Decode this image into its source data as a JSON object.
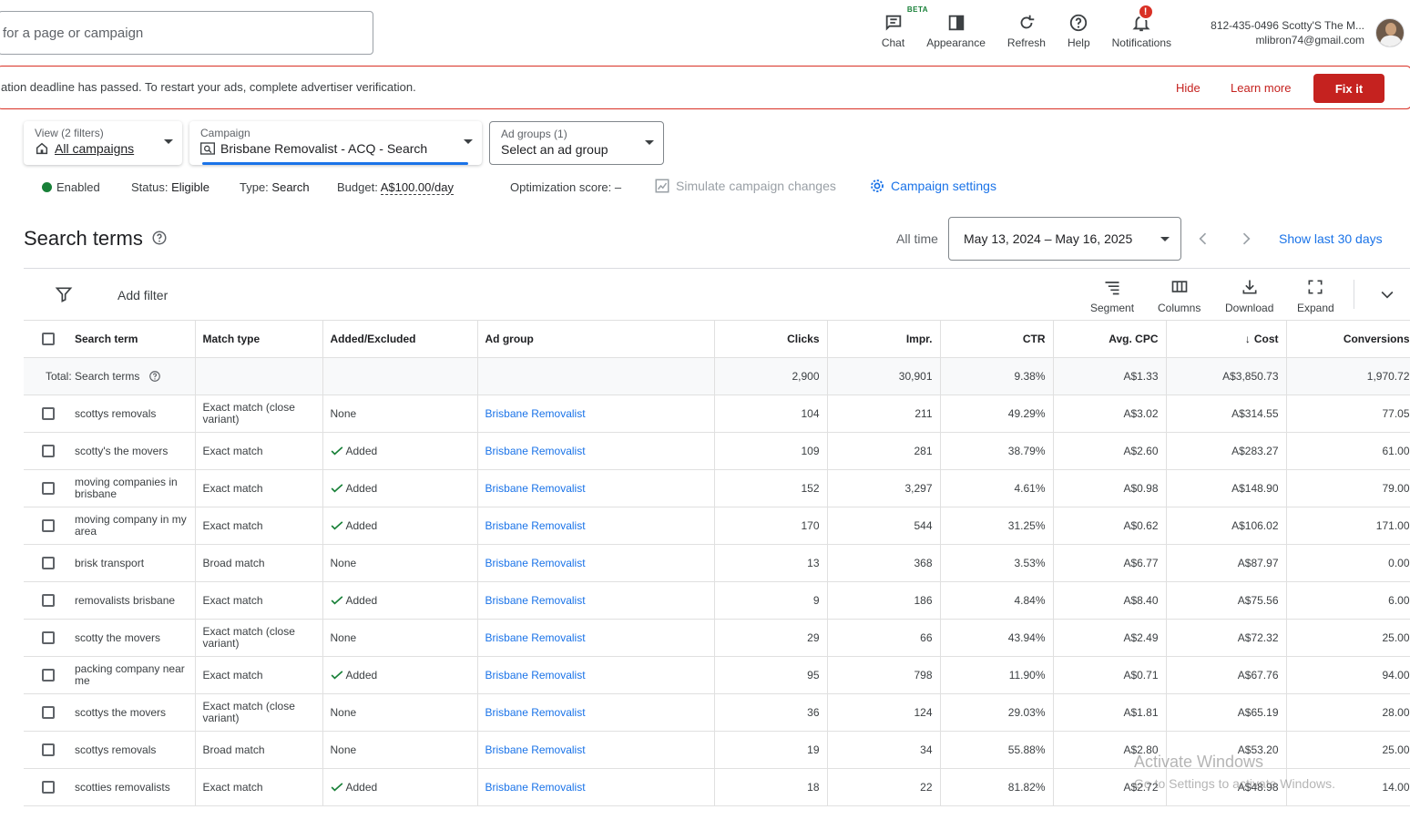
{
  "search": {
    "placeholder": "for a page or campaign"
  },
  "top_actions": [
    {
      "label": "Chat",
      "icon": "chat-icon",
      "badge": "BETA"
    },
    {
      "label": "Appearance",
      "icon": "appearance-icon"
    },
    {
      "label": "Refresh",
      "icon": "refresh-icon"
    },
    {
      "label": "Help",
      "icon": "help-icon"
    },
    {
      "label": "Notifications",
      "icon": "bell-icon",
      "badge": "!"
    }
  ],
  "account": {
    "name": "812-435-0496 Scotty'S The M...",
    "email": "mlibron74@gmail.com"
  },
  "alert": {
    "text": "ation deadline has passed. To restart your ads, complete advertiser verification.",
    "hide": "Hide",
    "learn_more": "Learn more",
    "fix": "Fix it"
  },
  "selectors": {
    "view": {
      "label": "View (2 filters)",
      "value": "All campaigns"
    },
    "campaign": {
      "label": "Campaign",
      "value": "Brisbane Removalist - ACQ - Search"
    },
    "adgroups": {
      "label": "Ad groups (1)",
      "value": "Select an ad group"
    }
  },
  "status": {
    "enabled": "Enabled",
    "status_label": "Status:",
    "status_value": "Eligible",
    "type_label": "Type:",
    "type_value": "Search",
    "budget_label": "Budget:",
    "budget_value": "A$100.00/day",
    "opt_label": "Optimization score:",
    "opt_value": "–",
    "simulate": "Simulate campaign changes",
    "settings": "Campaign settings"
  },
  "page": {
    "title": "Search terms",
    "all_time": "All time",
    "date_range": "May 13, 2024 – May 16, 2025",
    "show_last": "Show last 30 days"
  },
  "toolbar": {
    "add_filter": "Add filter",
    "segment": "Segment",
    "columns": "Columns",
    "download": "Download",
    "expand": "Expand"
  },
  "table": {
    "headers": [
      "Search term",
      "Match type",
      "Added/Excluded",
      "Ad group",
      "Clicks",
      "Impr.",
      "CTR",
      "Avg. CPC",
      "Cost",
      "Conversions"
    ],
    "total": {
      "label": "Total: Search terms",
      "clicks": "2,900",
      "impr": "30,901",
      "ctr": "9.38%",
      "cpc": "A$1.33",
      "cost": "A$3,850.73",
      "conv": "1,970.72"
    },
    "rows": [
      {
        "term": "scottys removals",
        "match": "Exact match (close variant)",
        "added": "None",
        "group": "Brisbane Removalist",
        "clicks": "104",
        "impr": "211",
        "ctr": "49.29%",
        "cpc": "A$3.02",
        "cost": "A$314.55",
        "conv": "77.05"
      },
      {
        "term": "scotty's the movers",
        "match": "Exact match",
        "added": "Added",
        "group": "Brisbane Removalist",
        "clicks": "109",
        "impr": "281",
        "ctr": "38.79%",
        "cpc": "A$2.60",
        "cost": "A$283.27",
        "conv": "61.00"
      },
      {
        "term": "moving companies in brisbane",
        "match": "Exact match",
        "added": "Added",
        "group": "Brisbane Removalist",
        "clicks": "152",
        "impr": "3,297",
        "ctr": "4.61%",
        "cpc": "A$0.98",
        "cost": "A$148.90",
        "conv": "79.00"
      },
      {
        "term": "moving company in my area",
        "match": "Exact match",
        "added": "Added",
        "group": "Brisbane Removalist",
        "clicks": "170",
        "impr": "544",
        "ctr": "31.25%",
        "cpc": "A$0.62",
        "cost": "A$106.02",
        "conv": "171.00"
      },
      {
        "term": "brisk transport",
        "match": "Broad match",
        "added": "None",
        "group": "Brisbane Removalist",
        "clicks": "13",
        "impr": "368",
        "ctr": "3.53%",
        "cpc": "A$6.77",
        "cost": "A$87.97",
        "conv": "0.00"
      },
      {
        "term": "removalists brisbane",
        "match": "Exact match",
        "added": "Added",
        "group": "Brisbane Removalist",
        "clicks": "9",
        "impr": "186",
        "ctr": "4.84%",
        "cpc": "A$8.40",
        "cost": "A$75.56",
        "conv": "6.00"
      },
      {
        "term": "scotty the movers",
        "match": "Exact match (close variant)",
        "added": "None",
        "group": "Brisbane Removalist",
        "clicks": "29",
        "impr": "66",
        "ctr": "43.94%",
        "cpc": "A$2.49",
        "cost": "A$72.32",
        "conv": "25.00"
      },
      {
        "term": "packing company near me",
        "match": "Exact match",
        "added": "Added",
        "group": "Brisbane Removalist",
        "clicks": "95",
        "impr": "798",
        "ctr": "11.90%",
        "cpc": "A$0.71",
        "cost": "A$67.76",
        "conv": "94.00"
      },
      {
        "term": "scottys the movers",
        "match": "Exact match (close variant)",
        "added": "None",
        "group": "Brisbane Removalist",
        "clicks": "36",
        "impr": "124",
        "ctr": "29.03%",
        "cpc": "A$1.81",
        "cost": "A$65.19",
        "conv": "28.00"
      },
      {
        "term": "scottys removals",
        "match": "Broad match",
        "added": "None",
        "group": "Brisbane Removalist",
        "clicks": "19",
        "impr": "34",
        "ctr": "55.88%",
        "cpc": "A$2.80",
        "cost": "A$53.20",
        "conv": "25.00"
      },
      {
        "term": "scotties removalists",
        "match": "Exact match",
        "added": "Added",
        "group": "Brisbane Removalist",
        "clicks": "18",
        "impr": "22",
        "ctr": "81.82%",
        "cpc": "A$2.72",
        "cost": "A$48.98",
        "conv": "14.00"
      }
    ]
  },
  "watermark": {
    "line1": "Activate Windows",
    "line2": "Go to Settings to activate Windows."
  },
  "colors": {
    "accent": "#1a73e8",
    "error": "#c5221f",
    "enabled": "#188038"
  }
}
